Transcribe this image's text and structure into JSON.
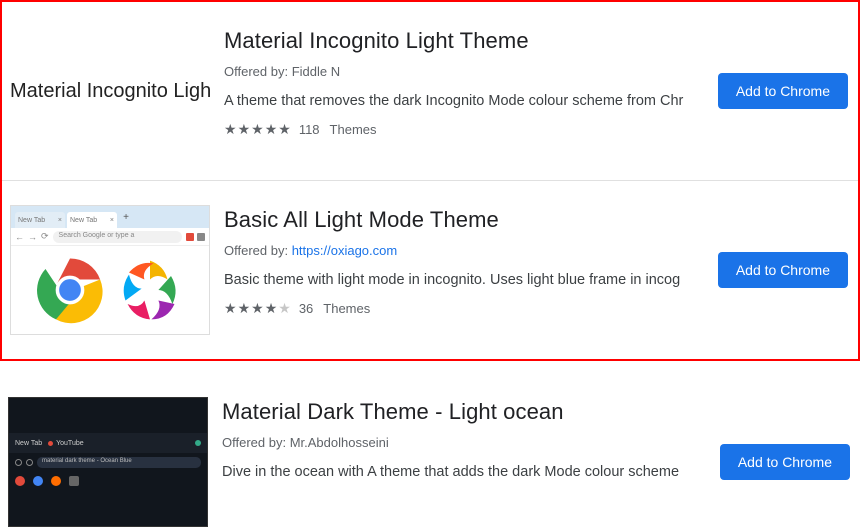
{
  "common": {
    "offered_prefix": "Offered by:",
    "category": "Themes",
    "add_button": "Add to Chrome"
  },
  "items": [
    {
      "title": "Material Incognito Light Theme",
      "offered_by_text": "Fiddle N",
      "offered_by_link": false,
      "thumb_text": "Material Incognito Light",
      "description": "A theme that removes the dark Incognito Mode colour scheme from Chr",
      "stars_full": 5,
      "stars_empty": 0,
      "rating_count": "118"
    },
    {
      "title": "Basic All Light Mode Theme",
      "offered_by_text": "https://oxiago.com",
      "offered_by_link": true,
      "description": "Basic theme with light mode in incognito. Uses light blue frame in incog",
      "stars_full": 4,
      "stars_empty": 1,
      "rating_count": "36",
      "browser": {
        "tab1": "New Tab",
        "tab2": "New Tab",
        "search": "Search Google or type a"
      }
    },
    {
      "title": "Material Dark Theme - Light ocean",
      "offered_by_text": "Mr.Abdolhosseini",
      "offered_by_link": false,
      "description": "Dive in the ocean with A theme that adds the dark Mode colour scheme",
      "stars_full": 0,
      "stars_empty": 0,
      "rating_count": "",
      "browser": {
        "tab1": "New Tab",
        "tab2": "YouTube",
        "url": "material dark theme - Ocean Blue"
      }
    }
  ]
}
